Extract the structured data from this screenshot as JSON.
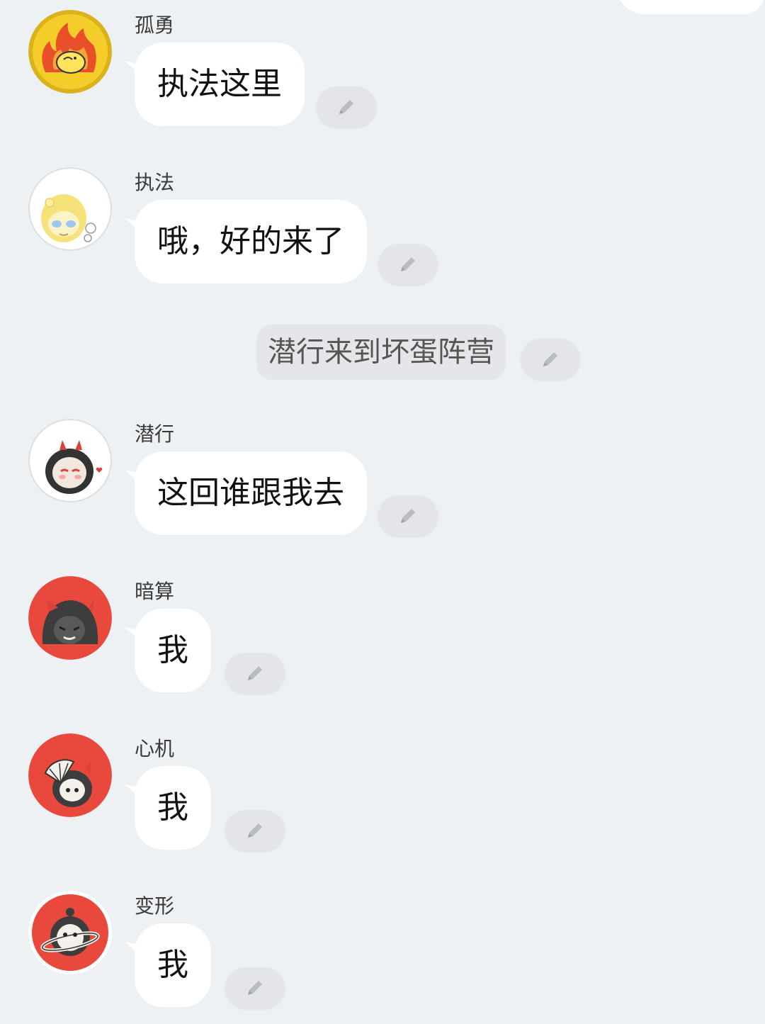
{
  "messages": [
    {
      "sender": "孤勇",
      "text": "执法这里",
      "avatar": "flame-avatar-icon"
    },
    {
      "sender": "执法",
      "text": "哦，好的来了",
      "avatar": "yellow-doll-avatar-icon"
    },
    {
      "sender": "潜行",
      "text": "这回谁跟我去",
      "avatar": "devil-girl-avatar-icon"
    },
    {
      "sender": "暗算",
      "text": "我",
      "avatar": "hooded-devil-avatar-icon"
    },
    {
      "sender": "心机",
      "text": "我",
      "avatar": "fan-devil-avatar-icon"
    },
    {
      "sender": "变形",
      "text": "我",
      "avatar": "planet-panda-avatar-icon"
    }
  ],
  "system_message": {
    "text": "潜行来到坏蛋阵营"
  },
  "icons": {
    "edit": "pencil-icon"
  },
  "colors": {
    "background": "#eef1f4",
    "bubble": "#ffffff",
    "edit_button": "#e3e5e8",
    "avatar_red": "#e8493c",
    "avatar_yellow": "#f4cd2a"
  }
}
